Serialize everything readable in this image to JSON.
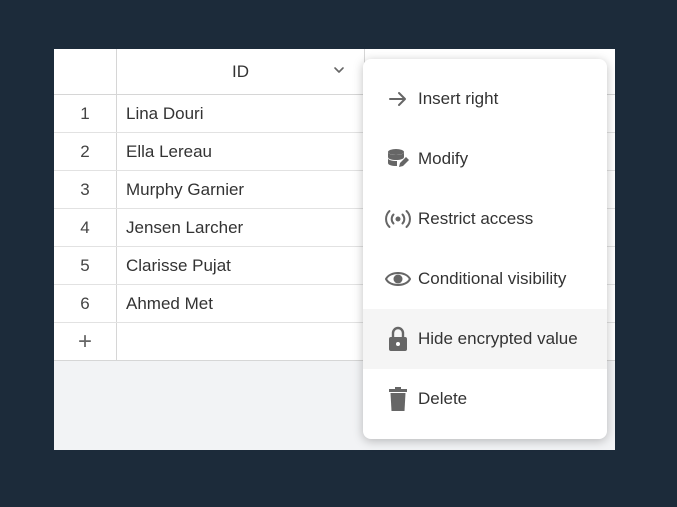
{
  "grid": {
    "column_header": "ID",
    "rows": [
      {
        "num": "1",
        "name": "Lina Douri"
      },
      {
        "num": "2",
        "name": "Ella Lereau"
      },
      {
        "num": "3",
        "name": "Murphy Garnier"
      },
      {
        "num": "4",
        "name": "Jensen Larcher"
      },
      {
        "num": "5",
        "name": "Clarisse Pujat"
      },
      {
        "num": "6",
        "name": "Ahmed Met"
      }
    ],
    "add_row_symbol": "+"
  },
  "menu": {
    "items": [
      {
        "label": "Insert right",
        "icon": "arrow-right-icon"
      },
      {
        "label": "Modify",
        "icon": "database-edit-icon"
      },
      {
        "label": "Restrict access",
        "icon": "broadcast-icon"
      },
      {
        "label": "Conditional visibility",
        "icon": "eye-icon"
      },
      {
        "label": "Hide encrypted value",
        "icon": "lock-icon"
      },
      {
        "label": "Delete",
        "icon": "trash-icon"
      }
    ]
  },
  "colors": {
    "background": "#1c2b3a",
    "icon": "#666666",
    "highlight": "#f5f5f5"
  }
}
